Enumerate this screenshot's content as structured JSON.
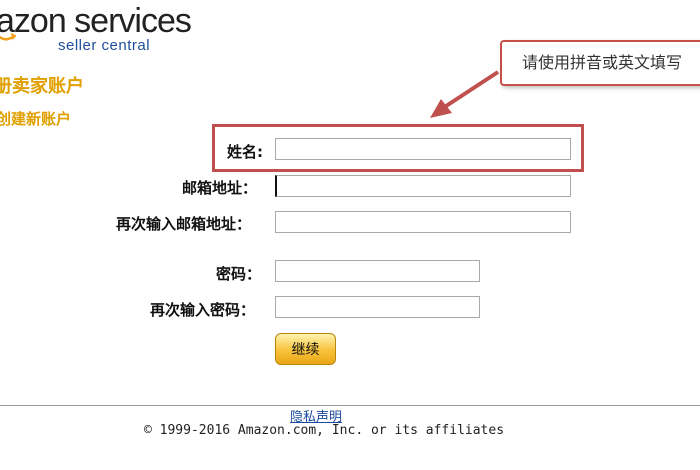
{
  "logo": {
    "main": "azon services",
    "sub": "seller central",
    "smile_icon": "amazon-smile-icon",
    "accent": "#e0a000"
  },
  "header": {
    "title": "册卖家账户",
    "subtitle": "创建新账户"
  },
  "callout": {
    "text": "请使用拼音或英文填写",
    "color": "#c0504d"
  },
  "form": {
    "name_label": "姓名:",
    "name_value": "",
    "email_label": "邮箱地址：",
    "email_value": "",
    "email_confirm_label": "再次输入邮箱地址：",
    "email_confirm_value": "",
    "password_label": "密码：",
    "password_value": "",
    "password_confirm_label": "再次输入密码：",
    "password_confirm_value": "",
    "continue_label": "继续"
  },
  "footer": {
    "privacy_link": "隐私声明",
    "copyright": "© 1999-2016 Amazon.com, Inc. or its affiliates"
  }
}
